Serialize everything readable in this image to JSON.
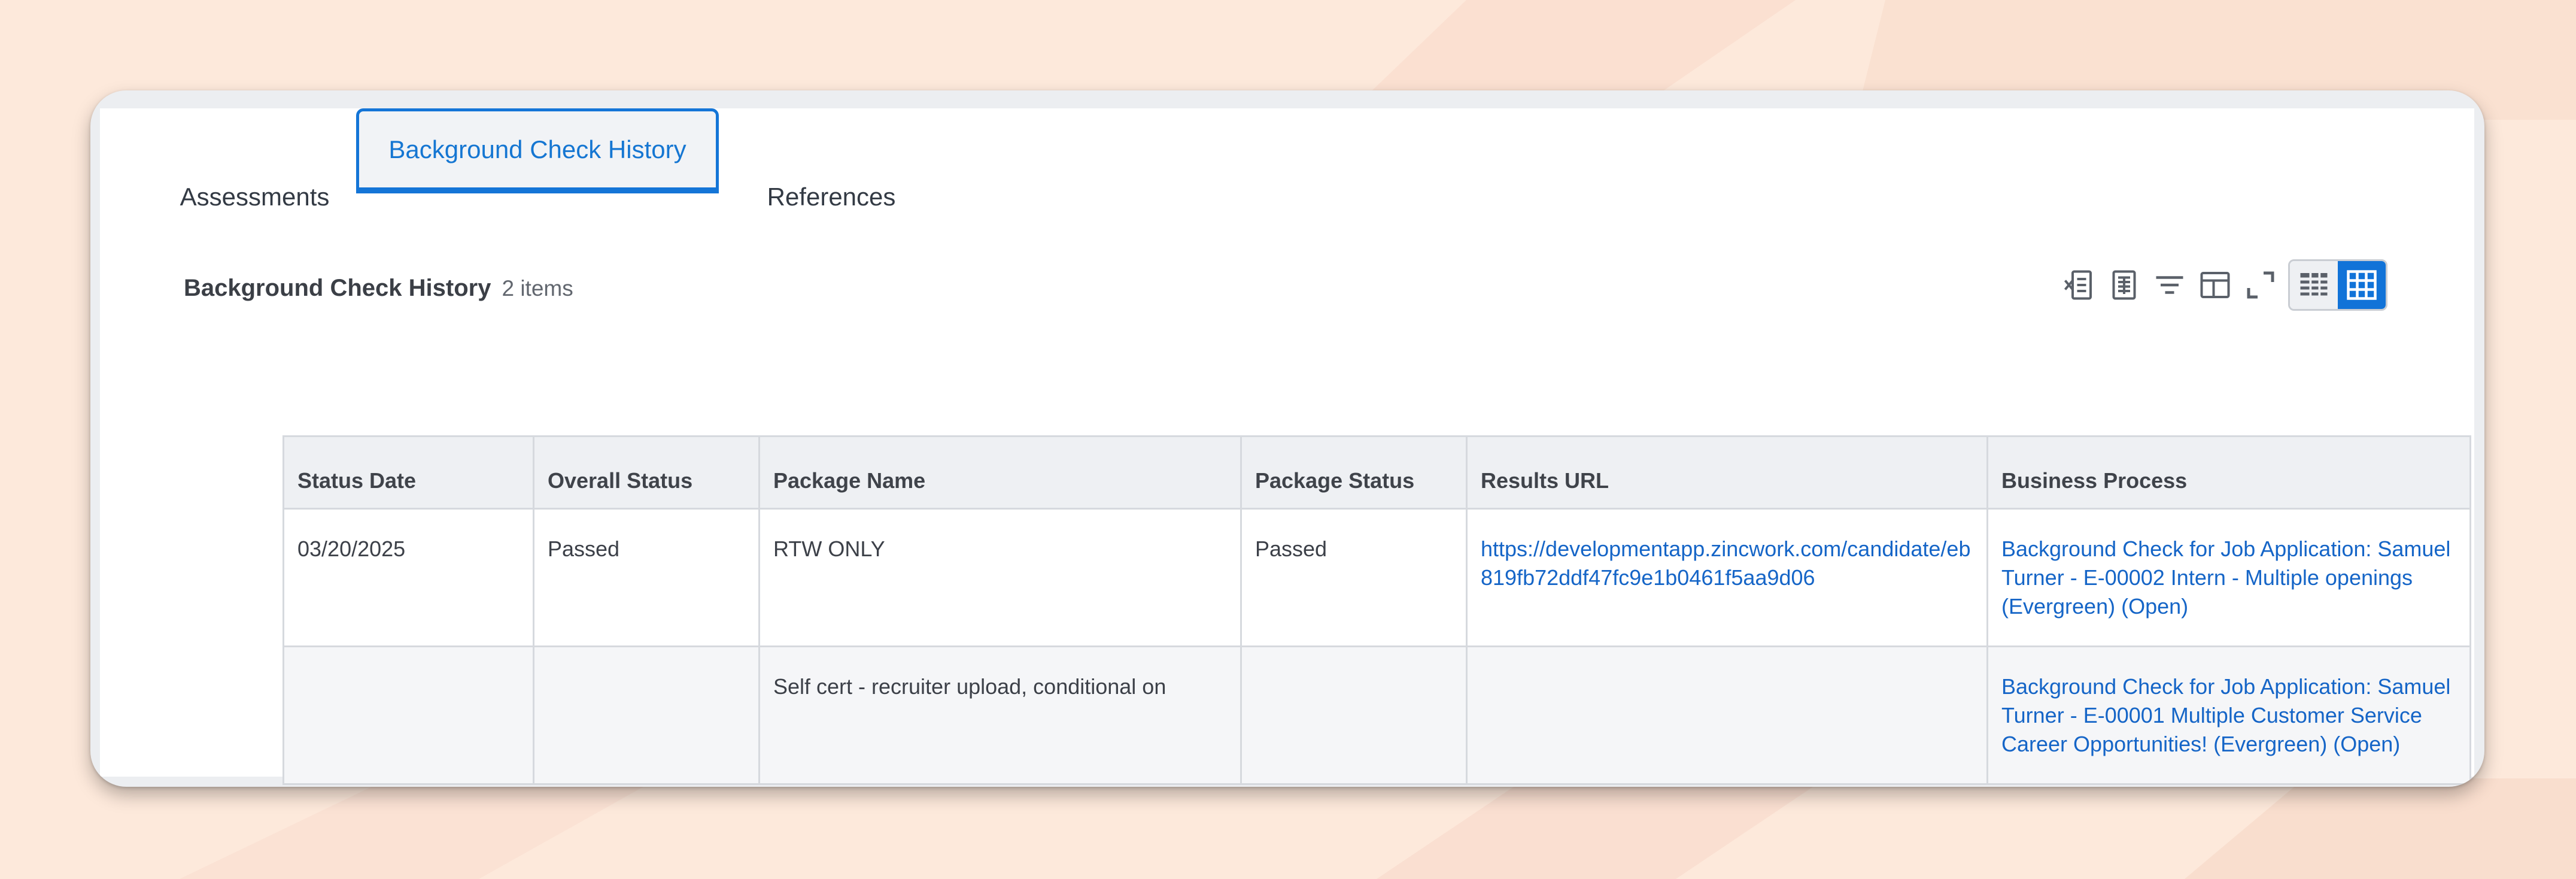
{
  "tabs": [
    {
      "label": "Assessments",
      "active": false
    },
    {
      "label": "Background Check History",
      "active": true
    },
    {
      "label": "References",
      "active": false
    }
  ],
  "grid": {
    "title": "Background Check History",
    "count": "2 items",
    "toolbar": [
      "export-excel-icon",
      "print-icon",
      "filter-icon",
      "table-config-icon",
      "fullscreen-icon",
      "table-view-icon",
      "grid-view-icon"
    ],
    "columns": [
      "Status Date",
      "Overall Status",
      "Package Name",
      "Package Status",
      "Results URL",
      "Business Process"
    ],
    "rows": [
      {
        "status_date": "03/20/2025",
        "overall_status": "Passed",
        "package_name": "RTW ONLY",
        "package_status": "Passed",
        "results_url": "https://developmentapp.zincwork.com/candidate/eb819fb72ddf47fc9e1b0461f5aa9d06",
        "business_process": "Background Check for Job Application: Samuel Turner - E-00002 Intern - Multiple openings (Evergreen) (Open)"
      },
      {
        "status_date": "",
        "overall_status": "",
        "package_name": "Self cert - recruiter upload, conditional on",
        "package_status": "",
        "results_url": "",
        "business_process": "Background Check for Job Application: Samuel Turner - E-00001 Multiple Customer Service Career Opportunities! (Evergreen) (Open)"
      }
    ]
  },
  "colors": {
    "background": "#fde9db",
    "accent": "#1475d7",
    "link": "#1565c7"
  }
}
